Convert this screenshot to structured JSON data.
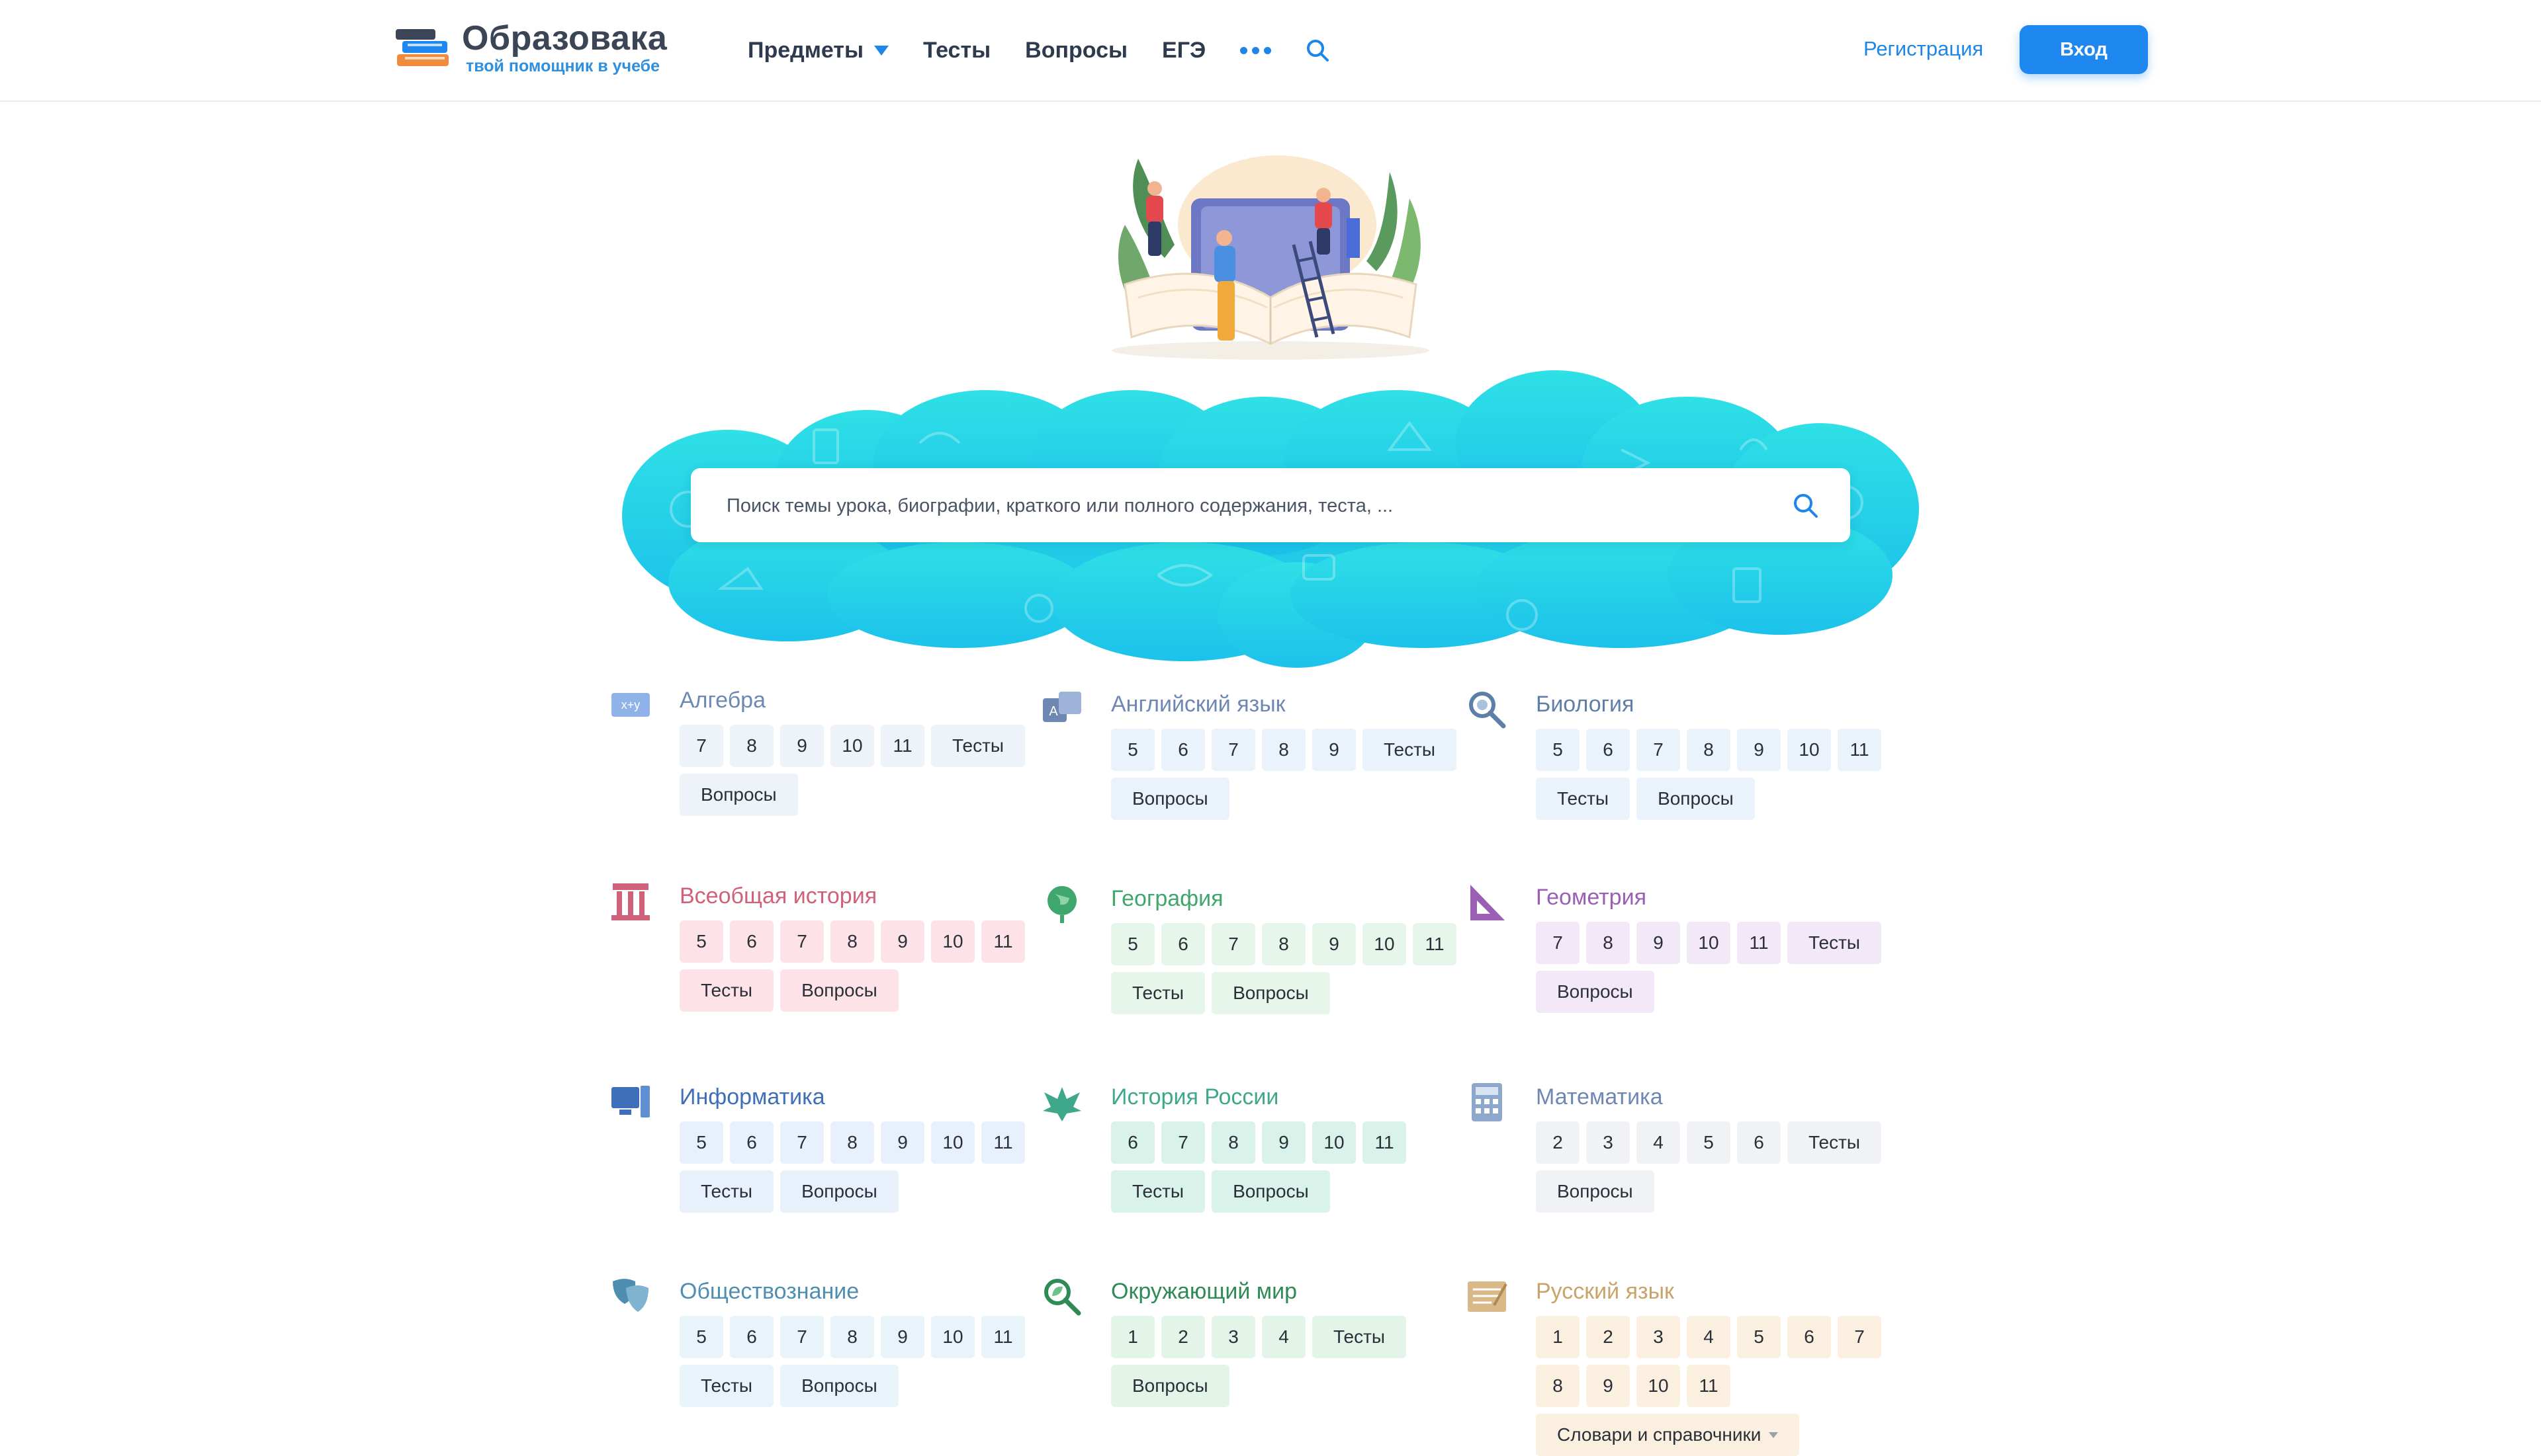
{
  "header": {
    "logo_title": "Образовака",
    "logo_subtitle": "твой помощник в учебе",
    "nav": [
      {
        "label": "Предметы"
      },
      {
        "label": "Тесты"
      },
      {
        "label": "Вопросы"
      },
      {
        "label": "ЕГЭ"
      }
    ],
    "register_label": "Регистрация",
    "login_label": "Вход"
  },
  "search": {
    "placeholder": "Поиск темы урока, биографии, краткого или полного содержания, теста, ..."
  },
  "colors": {
    "accent": "#1e88f0",
    "cloud": "#2ad6e6"
  },
  "subjects": [
    {
      "title": "Алгебра",
      "icon": "algebra-icon",
      "color": "#6f88b3",
      "chip_bg": "#eef2f9",
      "chips": [
        "7",
        "8",
        "9",
        "10",
        "11",
        "Тесты",
        "Вопросы"
      ]
    },
    {
      "title": "Английский язык",
      "icon": "language-icon",
      "color": "#6f88b3",
      "chip_bg": "#eaf2fb",
      "chips": [
        "5",
        "6",
        "7",
        "8",
        "9",
        "Тесты",
        "Вопросы"
      ]
    },
    {
      "title": "Биология",
      "icon": "magnifier-bio-icon",
      "color": "#5f7fa8",
      "chip_bg": "#eaf2fb",
      "chips": [
        "5",
        "6",
        "7",
        "8",
        "9",
        "10",
        "11",
        "Тесты",
        "Вопросы"
      ]
    },
    {
      "title": "Всеобщая история",
      "icon": "column-icon",
      "color": "#d0617a",
      "chip_bg": "#fde3e8",
      "chips": [
        "5",
        "6",
        "7",
        "8",
        "9",
        "10",
        "11",
        "Тесты",
        "Вопросы"
      ]
    },
    {
      "title": "География",
      "icon": "globe-icon",
      "color": "#3fa66c",
      "chip_bg": "#e6f6ea",
      "chips": [
        "5",
        "6",
        "7",
        "8",
        "9",
        "10",
        "11",
        "Тесты",
        "Вопросы"
      ]
    },
    {
      "title": "Геометрия",
      "icon": "set-square-icon",
      "color": "#9a5fb5",
      "chip_bg": "#f3e8f8",
      "chips": [
        "7",
        "8",
        "9",
        "10",
        "11",
        "Тесты",
        "Вопросы"
      ]
    },
    {
      "title": "Информатика",
      "icon": "computer-icon",
      "color": "#3f6fb8",
      "chip_bg": "#e8f1fb",
      "chips": [
        "5",
        "6",
        "7",
        "8",
        "9",
        "10",
        "11",
        "Тесты",
        "Вопросы"
      ]
    },
    {
      "title": "История России",
      "icon": "eagle-icon",
      "color": "#3fa88a",
      "chip_bg": "#d9f2ea",
      "chips": [
        "6",
        "7",
        "8",
        "9",
        "10",
        "11",
        "Тесты",
        "Вопросы"
      ]
    },
    {
      "title": "Математика",
      "icon": "calculator-icon",
      "color": "#6f88b3",
      "chip_bg": "#f0f2f5",
      "chips": [
        "2",
        "3",
        "4",
        "5",
        "6",
        "Тесты",
        "Вопросы"
      ]
    },
    {
      "title": "Обществознание",
      "icon": "masks-icon",
      "color": "#4f8eb0",
      "chip_bg": "#e8f4fa",
      "chips": [
        "5",
        "6",
        "7",
        "8",
        "9",
        "10",
        "11",
        "Тесты",
        "Вопросы"
      ]
    },
    {
      "title": "Окружающий мир",
      "icon": "magnifier-leaf-icon",
      "color": "#2f8a55",
      "chip_bg": "#e3f5e8",
      "chips": [
        "1",
        "2",
        "3",
        "4",
        "Тесты",
        "Вопросы"
      ]
    },
    {
      "title": "Русский язык",
      "icon": "notebook-icon",
      "color": "#c9a46a",
      "chip_bg": "#fbf0e0",
      "chips": [
        "1",
        "2",
        "3",
        "4",
        "5",
        "6",
        "7",
        "8",
        "9",
        "10",
        "11",
        "Словари и справочники"
      ]
    }
  ]
}
